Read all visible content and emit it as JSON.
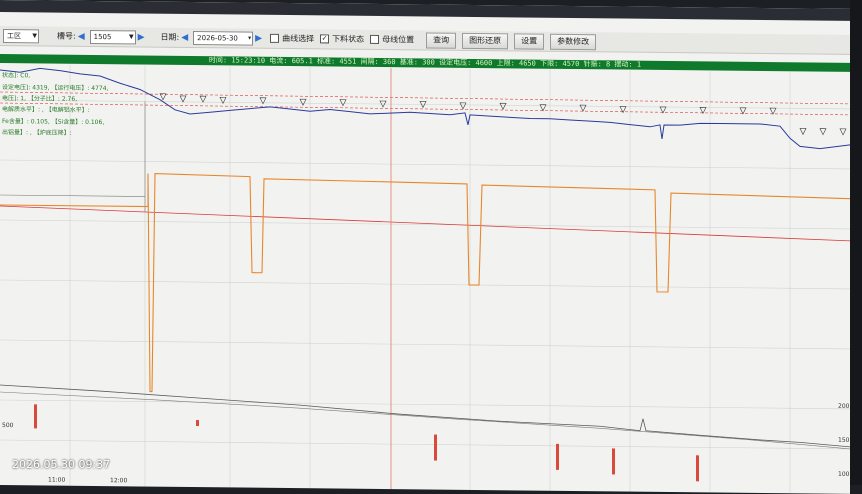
{
  "toolbar": {
    "workshop_label": "工区",
    "slot_label": "槽号:",
    "slot_value": "1505",
    "date_label": "日期:",
    "date_value": "2026-05-30",
    "curve_select_label": "曲线选择",
    "discharge_state_label": "下料状态",
    "busbar_position_label": "母线位置",
    "query_button": "查询",
    "restore_button": "图形还原",
    "settings_button": "设置",
    "params_button": "参数修改"
  },
  "status": {
    "text": "时间: 15:23:10 电流: 605.1 标准: 4551 间隔: 360 基准: 300 设定电压: 4600 上限: 4650 下限: 4570 针振: 8 摆动: 1"
  },
  "leftpanel": {
    "line1": "状态]: C0,",
    "line2": "设定电压]: 4319, 【运行电压】: 4774,",
    "line3": "电压]: 1, 【分子比】: 2.76,",
    "line4": "电解质水平】: , 【电解铝水平】:",
    "line5": "Fe含量】: 0.105, 【Si含量】: 0.106,",
    "line6": "出铝量】: , 【炉底压降】:"
  },
  "axis": {
    "right_ticks": [
      "200",
      "150",
      "100"
    ],
    "left_ticks": [
      "500"
    ],
    "x_ticks": [
      "11:00",
      "12:00"
    ]
  },
  "photo": {
    "timestamp": "2026.05.30 09:37"
  },
  "colors": {
    "voltage_line": "#2a3a9c",
    "feed_signal": "#e8862c",
    "setpoint_line": "#d93a3a",
    "status_bar": "#0f7a2b"
  }
}
